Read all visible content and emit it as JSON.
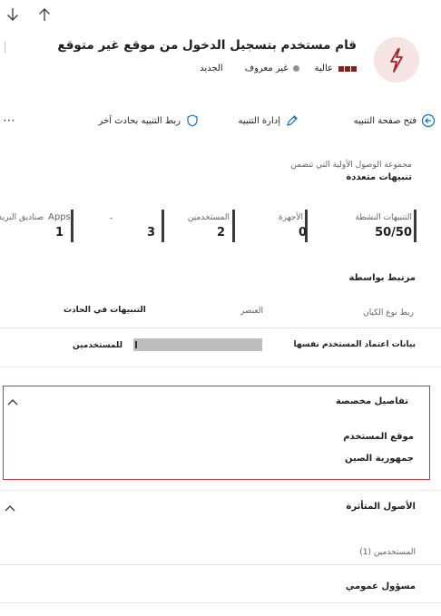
{
  "nav": {
    "down_icon": "arrow-down-icon",
    "up_icon": "arrow-up-icon"
  },
  "header": {
    "title": "قام مستخدم بتسجيل الدخول من موقع غير متوقع",
    "severity": "عالية",
    "status": "غير معروف",
    "classification": "الجديد",
    "colors": {
      "severity": "#8a1c1c",
      "icon_bg": "#f6e3e3",
      "icon": "#a4262c"
    }
  },
  "toolbar": {
    "open_page": "فتح صفحة التنبيه",
    "manage": "إدارة التنبيه",
    "link_incident": "ربط التنبيه بحادث آخر",
    "more": "⋯"
  },
  "group": {
    "caption": "مجموعة الوصول الأولية التي تتضمن",
    "title": "تنبيهات متعددة"
  },
  "stats": [
    {
      "label": "التنبيهات النشطة",
      "value": "50/50"
    },
    {
      "label": "الأجهزة",
      "value": "0"
    },
    {
      "label": "المستخدمين",
      "value": "2"
    },
    {
      "label": "",
      "value": "3"
    },
    {
      "label": "Apps",
      "value": ""
    },
    {
      "label": "صناديق البريد",
      "value": "1"
    }
  ],
  "correlated": {
    "title": "مرتبط بواسطة",
    "col1": "ربط نوع الكيان",
    "col2": "العنصر",
    "col3": "التنبيهات في الحادث",
    "row_label": "بيانات اعتماد المستخدم نفسها",
    "row_suffix": "للمستخدمين"
  },
  "custom_details": {
    "title": "تفاصيل مخصصة",
    "field_label": "موقع المستخدم",
    "field_value": "جمهورية الصين",
    "highlight_color": "#d13438"
  },
  "impacted": {
    "title": "الأصول المتأثرة",
    "users": "المستخدمين (1)"
  },
  "owner": {
    "title": "مسؤول عمومي"
  }
}
